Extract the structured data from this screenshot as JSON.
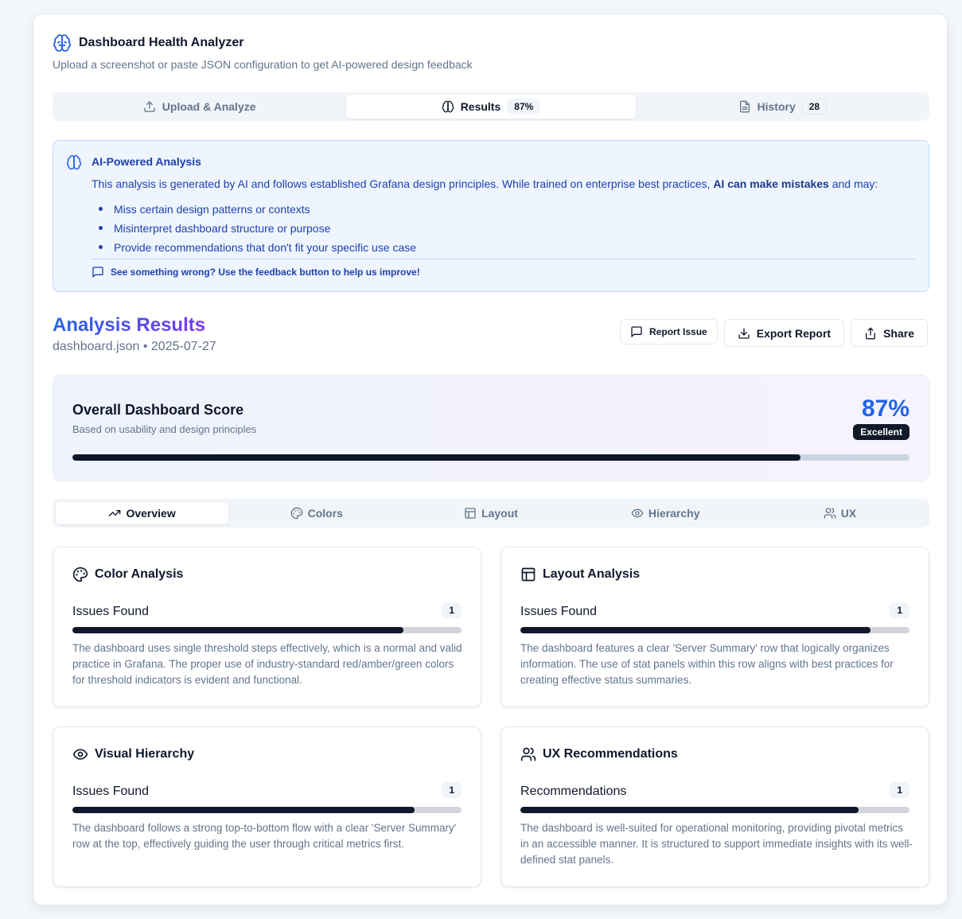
{
  "app": {
    "title": "Dashboard Health Analyzer",
    "subtitle": "Upload a screenshot or paste JSON configuration to get AI-powered design feedback",
    "icon": "brain-icon"
  },
  "top_tabs": [
    {
      "label": "Upload & Analyze",
      "icon": "upload-icon",
      "badge": null
    },
    {
      "label": "Results",
      "icon": "brain-icon",
      "badge": "87%"
    },
    {
      "label": "History",
      "icon": "file-text-icon",
      "badge": "28"
    }
  ],
  "notice": {
    "title": "AI-Powered Analysis",
    "body_prefix": "This analysis is generated by AI and follows established Grafana design principles. While trained on enterprise best practices, ",
    "body_bold": "AI can make mistakes",
    "body_suffix": " and may:",
    "bullets": [
      "Miss certain design patterns or contexts",
      "Misinterpret dashboard structure or purpose",
      "Provide recommendations that don't fit your specific use case"
    ],
    "footer": "See something wrong? Use the feedback button to help us improve!"
  },
  "results": {
    "title": "Analysis Results",
    "subtitle": "dashboard.json • 2025-07-27",
    "actions": {
      "report": "Report Issue",
      "export": "Export Report",
      "share": "Share"
    }
  },
  "score": {
    "title": "Overall Dashboard Score",
    "subtitle": "Based on usability and design principles",
    "value_text": "87%",
    "value": 87,
    "badge": "Excellent"
  },
  "sub_tabs": [
    {
      "label": "Overview",
      "icon": "trending-up-icon"
    },
    {
      "label": "Colors",
      "icon": "palette-icon"
    },
    {
      "label": "Layout",
      "icon": "layout-icon"
    },
    {
      "label": "Hierarchy",
      "icon": "eye-icon"
    },
    {
      "label": "UX",
      "icon": "users-icon"
    }
  ],
  "panels": [
    {
      "title": "Color Analysis",
      "icon": "palette-icon",
      "metric": "Issues Found",
      "count": "1",
      "progress": 85,
      "text": "The dashboard uses single threshold steps effectively, which is a normal and valid practice in Grafana. The proper use of industry-standard red/amber/green colors for threshold indicators is evident and functional."
    },
    {
      "title": "Layout Analysis",
      "icon": "layout-icon",
      "metric": "Issues Found",
      "count": "1",
      "progress": 90,
      "text": "The dashboard features a clear 'Server Summary' row that logically organizes information. The use of stat panels within this row aligns with best practices for creating effective status summaries."
    },
    {
      "title": "Visual Hierarchy",
      "icon": "eye-icon",
      "metric": "Issues Found",
      "count": "1",
      "progress": 88,
      "text": "The dashboard follows a strong top-to-bottom flow with a clear 'Server Summary' row at the top, effectively guiding the user through critical metrics first."
    },
    {
      "title": "UX Recommendations",
      "icon": "users-icon",
      "metric": "Recommendations",
      "count": "1",
      "progress": 87,
      "text": "The dashboard is well-suited for operational monitoring, providing pivotal metrics in an accessible manner. It is structured to support immediate insights with its well-defined stat panels."
    }
  ],
  "colors": {
    "accent": "#2563eb",
    "gradient_end": "#7c3aed",
    "notice_bg": "#eef5ff",
    "bar_fill": "#0f172a"
  }
}
